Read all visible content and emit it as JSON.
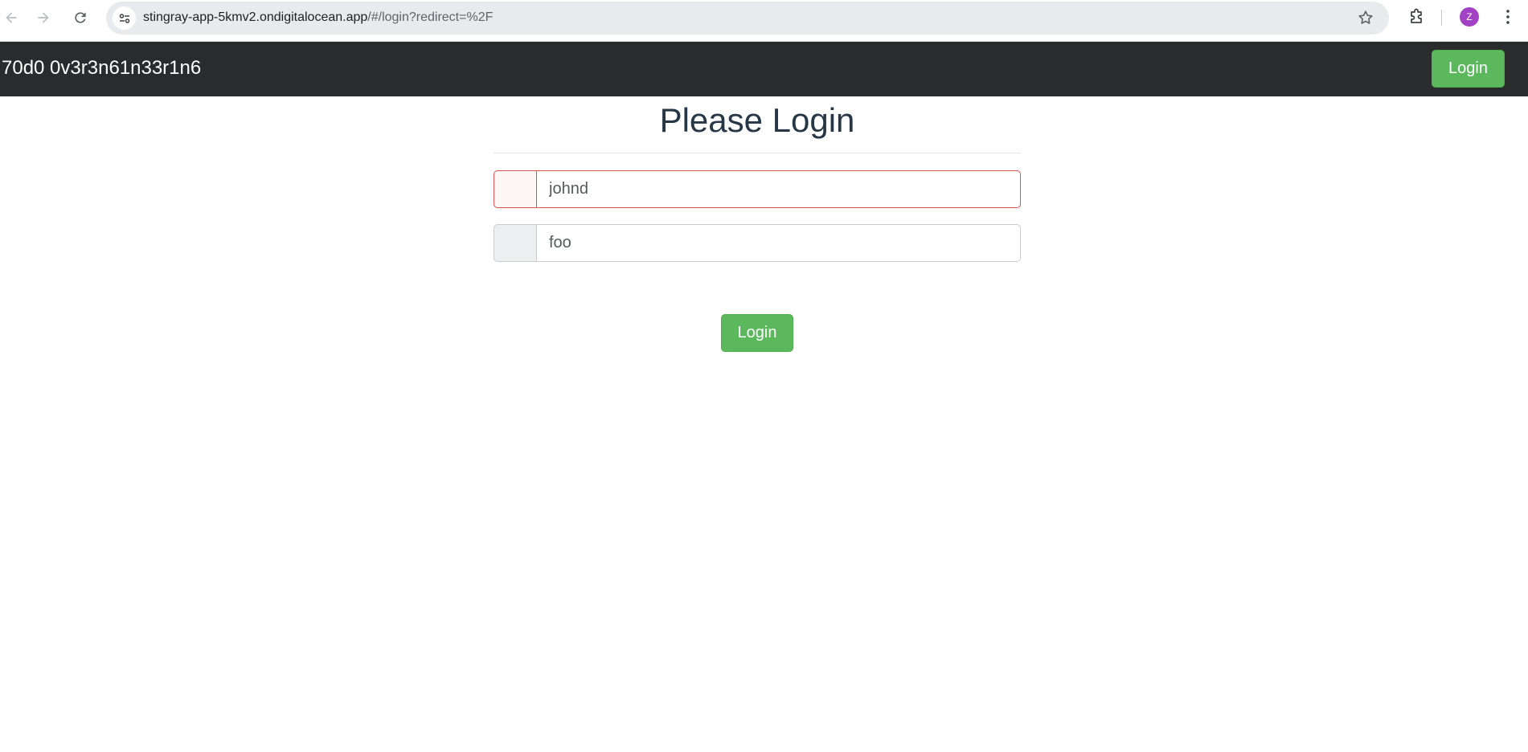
{
  "browser": {
    "url_host": "stingray-app-5kmv2.ondigitalocean.app",
    "url_path": "/#/login?redirect=%2F",
    "profile_initial": "Z",
    "icons": {
      "back": "arrow-left-icon",
      "forward": "arrow-right-icon",
      "reload": "reload-icon",
      "site_info": "tune-icon",
      "bookmark": "star-icon",
      "extensions": "puzzle-icon",
      "menu": "kebab-menu-icon"
    }
  },
  "navbar": {
    "brand": "70d0 0v3r3n61n33r1n6",
    "login_label": "Login"
  },
  "login_form": {
    "title": "Please Login",
    "username": {
      "value": "",
      "placeholder": "johnd",
      "state": "invalid"
    },
    "password": {
      "value": "",
      "placeholder": "foo"
    },
    "submit_label": "Login"
  },
  "colors": {
    "navbar_bg": "#292b2c",
    "success": "#5cb85c",
    "danger": "#d9534f",
    "title": "#283746"
  }
}
